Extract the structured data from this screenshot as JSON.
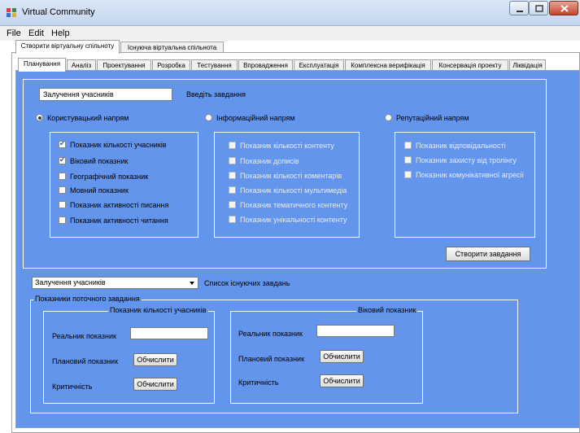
{
  "window": {
    "title": "Virtual Community",
    "icon": "app-icon"
  },
  "menu": [
    "File",
    "Edit",
    "Help"
  ],
  "outer_tabs": [
    {
      "label": "Створити віртуальну спільноту",
      "selected": true
    },
    {
      "label": "Існуюча віртуальна спільнота",
      "selected": false
    }
  ],
  "inner_tabs": [
    "Планування",
    "Аналіз",
    "Проектування",
    "Розробка",
    "Тестування",
    "Впровадження",
    "Експлуатація",
    "Комплексна верифікація",
    "Консервація проекту",
    "Ліквідація"
  ],
  "task": {
    "input_value": "Залучення учасників",
    "hint": "Введіть завдання"
  },
  "radios": [
    {
      "label": "Користувацький напрям",
      "checked": true
    },
    {
      "label": "Інформаційний напрям",
      "checked": false
    },
    {
      "label": "Репутаційний напрям",
      "checked": false
    }
  ],
  "user_indicators": [
    {
      "label": "Показник кількості учасників",
      "checked": true
    },
    {
      "label": "Віковий показник",
      "checked": true
    },
    {
      "label": "Географічний показник",
      "checked": false
    },
    {
      "label": "Мовний показник",
      "checked": false
    },
    {
      "label": "Показник активності писання",
      "checked": false
    },
    {
      "label": "Показник активності читання",
      "checked": false
    }
  ],
  "info_indicators": [
    "Показник кількості контенту",
    "Показник дописів",
    "Показник кількості коментарів",
    "Показник кількості мультимедіа",
    "Показник тематичного контенту",
    "Показник унікальності контенту"
  ],
  "reputation_indicators": [
    "Показник відповідальності",
    "Показник захисту від тролінгу",
    "Показник комунікативної агресії"
  ],
  "create_task_button": "Створити завдання",
  "existing": {
    "selected": "Залучення учасників",
    "label": "Список існуючих завдань"
  },
  "current_group_title": "Показники поточного завдання",
  "panels": [
    {
      "title": "Показник кількості учасників",
      "real_label": "Реальник показник",
      "planned_label": "Плановий показник",
      "critical_label": "Критичність",
      "calc_button": "Обчислити"
    },
    {
      "title": "Віковий показник",
      "real_label": "Реальник показник",
      "planned_label": "Плановий показник",
      "critical_label": "Критичність",
      "calc_button": "Обчислити"
    }
  ],
  "colors": {
    "panel_bg": "#6495ed",
    "window_bg": "#f0f0f0",
    "close_button": "#c2452d"
  }
}
